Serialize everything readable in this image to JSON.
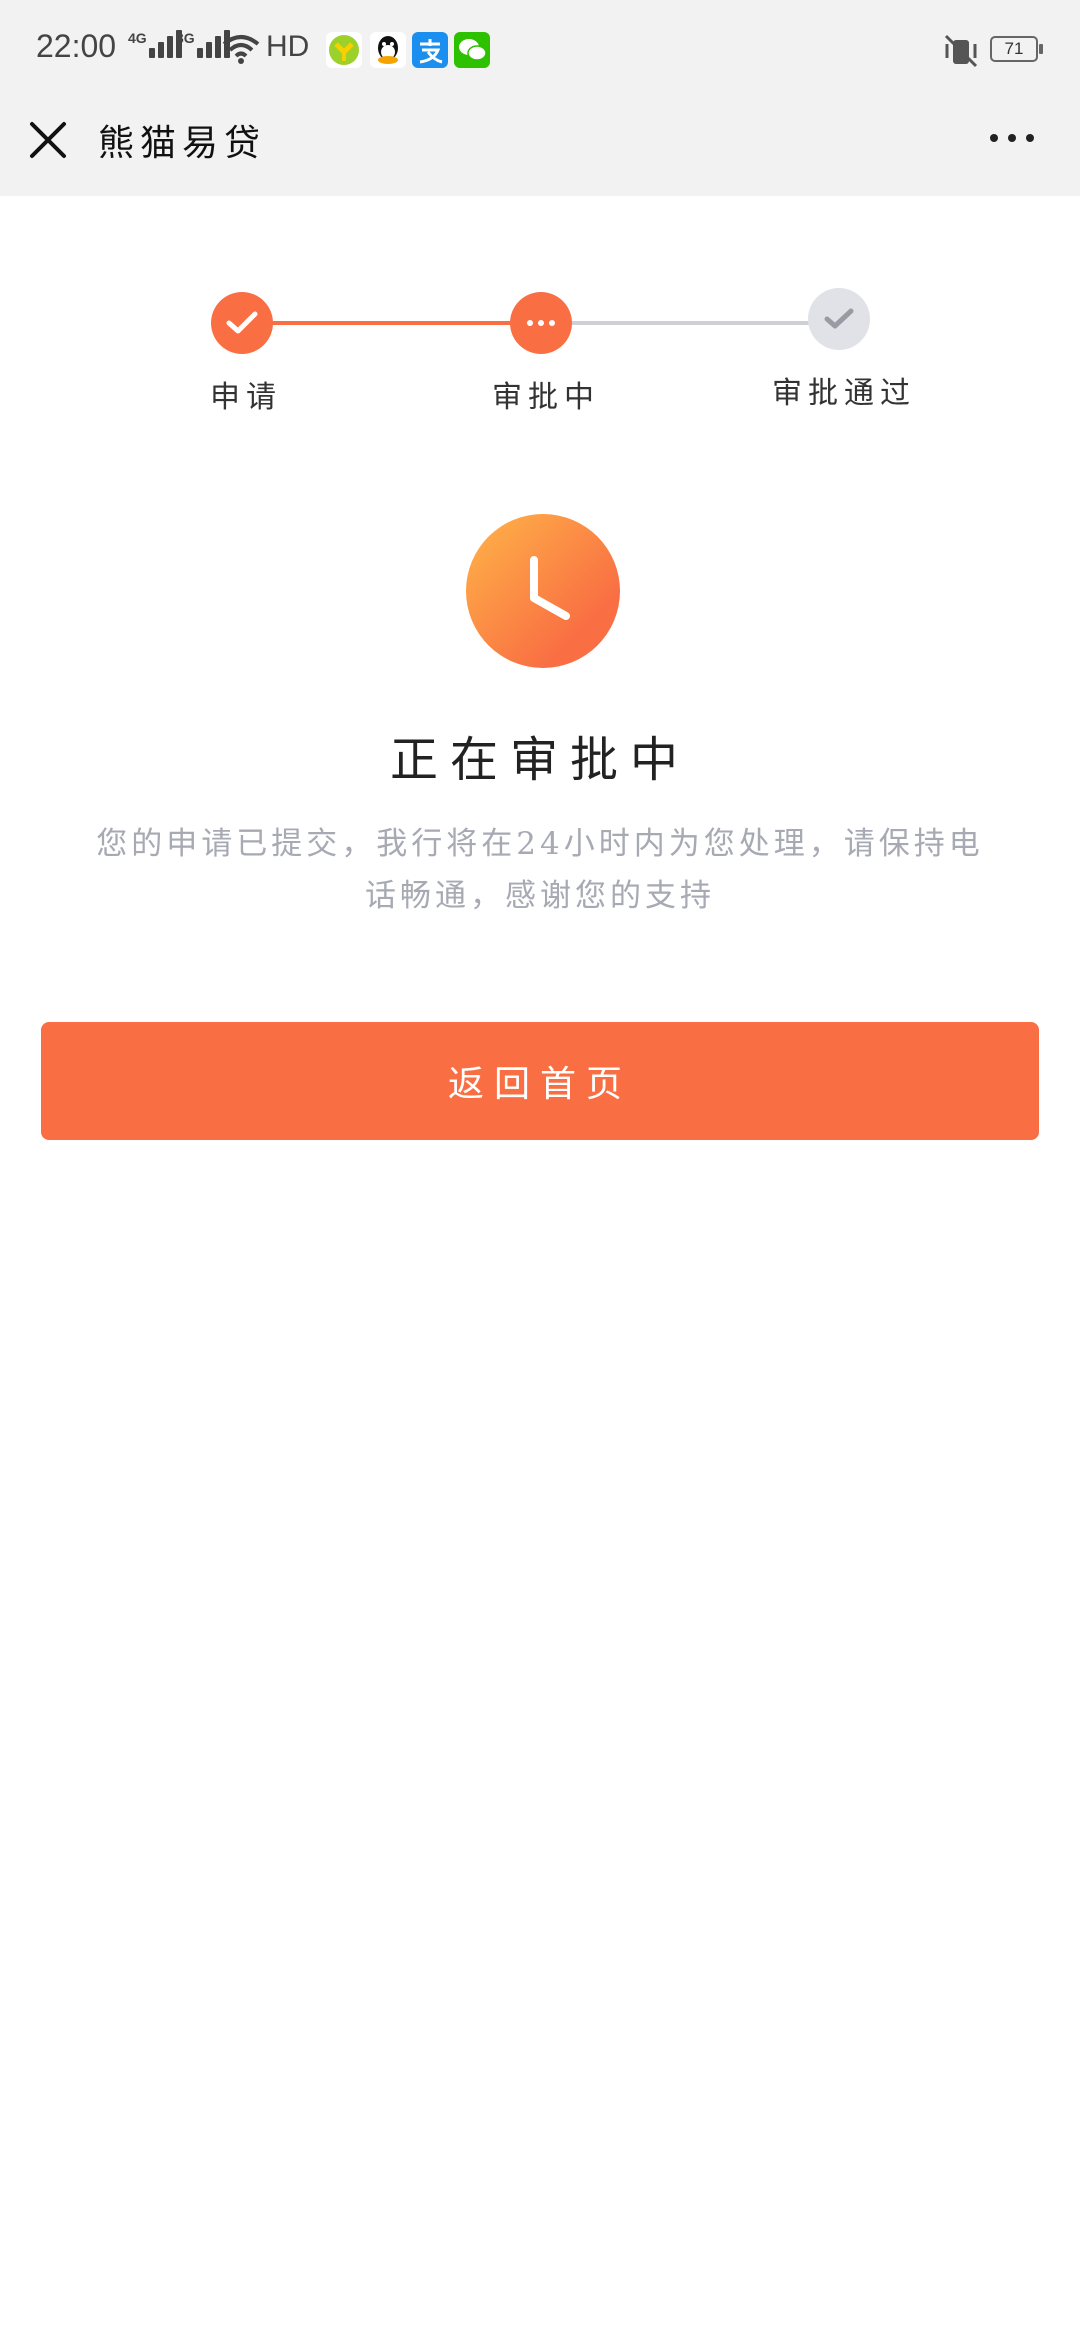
{
  "status_bar": {
    "time": "22:00",
    "network_1": "4G",
    "network_2": "3G",
    "hd": "HD",
    "battery": "71"
  },
  "nav": {
    "title": "熊猫易贷"
  },
  "steps": [
    {
      "label": "申请",
      "state": "done"
    },
    {
      "label": "审批中",
      "state": "active"
    },
    {
      "label": "审批通过",
      "state": "pending"
    }
  ],
  "main": {
    "status_title": "正在审批中",
    "description": "您的申请已提交，我行将在24小时内为您处理，请保持电话畅通，感谢您的支持",
    "home_button": "返回首页"
  },
  "colors": {
    "accent": "#f96f43",
    "pending": "#e1e1e8"
  }
}
